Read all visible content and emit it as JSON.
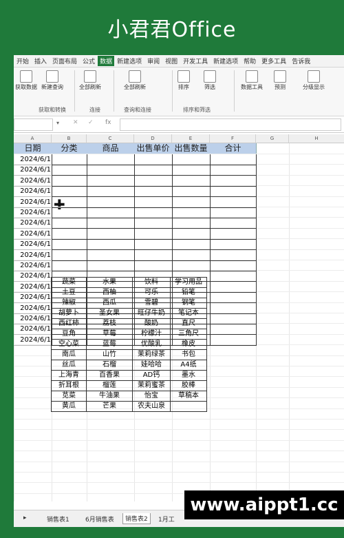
{
  "banner": {
    "title": "小君君Office"
  },
  "menu": [
    "开始",
    "插入",
    "页面布局",
    "公式",
    "数据",
    "新建选项",
    "审阅",
    "视图",
    "开发工具",
    "新建选项",
    "帮助",
    "更多工具",
    "告诉我"
  ],
  "menu_active_index": 4,
  "ribbon": {
    "buttons": [
      "获取数据",
      "新建查询",
      "全部刷新",
      "全部刷新",
      "排序",
      "筛选",
      "数据工具",
      "预测",
      "分级显示"
    ],
    "groups": [
      "获取和转换",
      "连接",
      "查询和连接",
      "排序和筛选"
    ]
  },
  "formula_bar": {
    "fx": "fx",
    "cancel": "✕",
    "enter": "✓"
  },
  "columns": [
    "A",
    "B",
    "C",
    "D",
    "E",
    "F",
    "G",
    "H"
  ],
  "headers": [
    "日期",
    "分类",
    "商品",
    "出售单价",
    "出售数量",
    "合计"
  ],
  "date_value": "2024/6/1",
  "rows": [
    "2024/6/1",
    "2024/6/1",
    "2024/6/1",
    "2024/6/1",
    "2024/6/1",
    "2024/6/1",
    "2024/6/1",
    "2024/6/1",
    "2024/6/1",
    "2024/6/1",
    "2024/6/1",
    "2024/6/1",
    "2024/6/1",
    "2024/6/1",
    "2024/6/1",
    "2024/6/1",
    "2024/6/1",
    "2024/6/1"
  ],
  "category_table": [
    [
      "蔬菜",
      "水果",
      "饮料",
      "学习用品"
    ],
    [
      "土豆",
      "西柚",
      "可乐",
      "铅笔"
    ],
    [
      "辣椒",
      "西瓜",
      "雪碧",
      "钢笔"
    ],
    [
      "胡萝卜",
      "圣女果",
      "旺仔牛奶",
      "笔记本"
    ],
    [
      "西红柿",
      "荔枝",
      "酸奶",
      "直尺"
    ],
    [
      "豆角",
      "草莓",
      "柠檬汁",
      "三角尺"
    ],
    [
      "空心菜",
      "蓝莓",
      "优酸乳",
      "橡皮"
    ],
    [
      "南瓜",
      "山竹",
      "茉莉绿茶",
      "书包"
    ],
    [
      "丝瓜",
      "石榴",
      "娃哈哈",
      "A4纸"
    ],
    [
      "上海青",
      "百香果",
      "AD钙",
      "墨水"
    ],
    [
      "折耳根",
      "榴莲",
      "茉莉蜜茶",
      "胶棒"
    ],
    [
      "苋菜",
      "牛油果",
      "怡宝",
      "草稿本"
    ],
    [
      "黄瓜",
      "芒果",
      "农夫山泉",
      ""
    ]
  ],
  "sheets": [
    "销售表1",
    "6月销售表",
    "销售表2",
    "1月工"
  ],
  "active_sheet_index": 2,
  "watermark": "www.aippt1.cc"
}
